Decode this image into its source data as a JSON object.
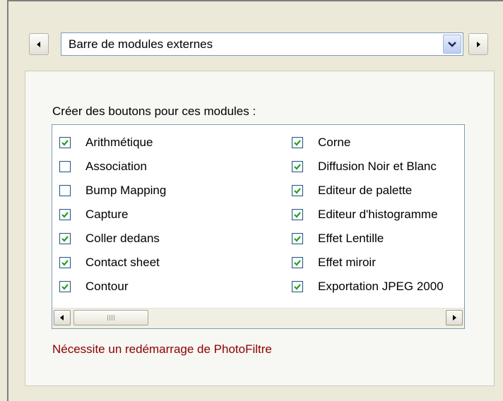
{
  "toolbar_selector": {
    "selected": "Barre de modules externes"
  },
  "panel": {
    "label": "Créer des boutons pour ces modules :",
    "warning": "Nécessite un redémarrage de PhotoFiltre",
    "warning_color": "#8b0000"
  },
  "modules_left": [
    {
      "label": "Arithmétique",
      "checked": true
    },
    {
      "label": "Association",
      "checked": false
    },
    {
      "label": "Bump Mapping",
      "checked": false
    },
    {
      "label": "Capture",
      "checked": true
    },
    {
      "label": "Coller dedans",
      "checked": true
    },
    {
      "label": "Contact sheet",
      "checked": true
    },
    {
      "label": "Contour",
      "checked": true
    }
  ],
  "modules_right": [
    {
      "label": "Corne",
      "checked": true
    },
    {
      "label": "Diffusion Noir et Blanc",
      "checked": true
    },
    {
      "label": "Editeur de palette",
      "checked": true
    },
    {
      "label": "Editeur d'histogramme",
      "checked": true
    },
    {
      "label": "Effet Lentille",
      "checked": true
    },
    {
      "label": "Effet miroir",
      "checked": true
    },
    {
      "label": "Exportation JPEG 2000",
      "checked": true
    }
  ],
  "icons": {
    "prev": "chevron-left-icon",
    "next": "chevron-right-icon",
    "dropdown": "chevron-down-icon",
    "check": "checkmark-icon",
    "check_color": "#21a121"
  }
}
